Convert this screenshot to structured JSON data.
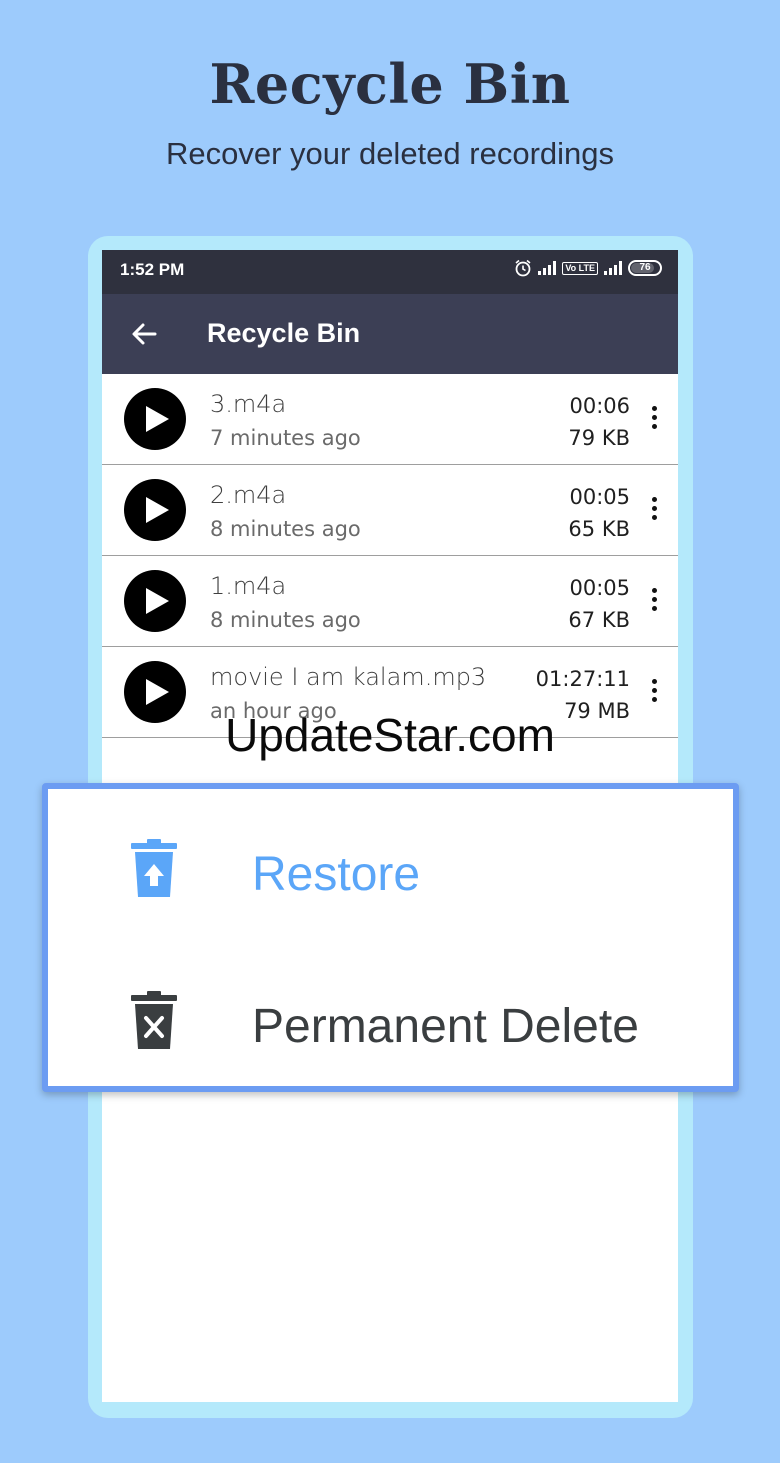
{
  "promo": {
    "title": "Recycle Bin",
    "subtitle": "Recover your deleted recordings"
  },
  "statusbar": {
    "time": "1:52 PM",
    "icons": [
      "alarm-icon",
      "signal-icon",
      "volte-icon",
      "signal-icon",
      "battery-icon"
    ],
    "volte_label": "Vo LTE",
    "battery": "76"
  },
  "appbar": {
    "title": "Recycle Bin",
    "back_icon": "arrow-left-icon"
  },
  "recordings": [
    {
      "name": "3.m4a",
      "when": "7 minutes ago",
      "duration": "00:06",
      "size": "79 KB"
    },
    {
      "name": "2.m4a",
      "when": "8 minutes ago",
      "duration": "00:05",
      "size": "65 KB"
    },
    {
      "name": "1.m4a",
      "when": "8 minutes ago",
      "duration": "00:05",
      "size": "67 KB"
    },
    {
      "name": "movie I am kalam.mp3",
      "when": "an hour ago",
      "duration": "01:27:11",
      "size": "79 MB"
    }
  ],
  "watermark": "UpdateStar.com",
  "menu": {
    "restore_label": "Restore",
    "delete_label": "Permanent Delete"
  },
  "colors": {
    "background": "#9dcbfc",
    "appbar": "#3c3f55",
    "statusbar": "#2f313e",
    "accent": "#5ba6f8",
    "menu_border": "#6c9cf2"
  }
}
